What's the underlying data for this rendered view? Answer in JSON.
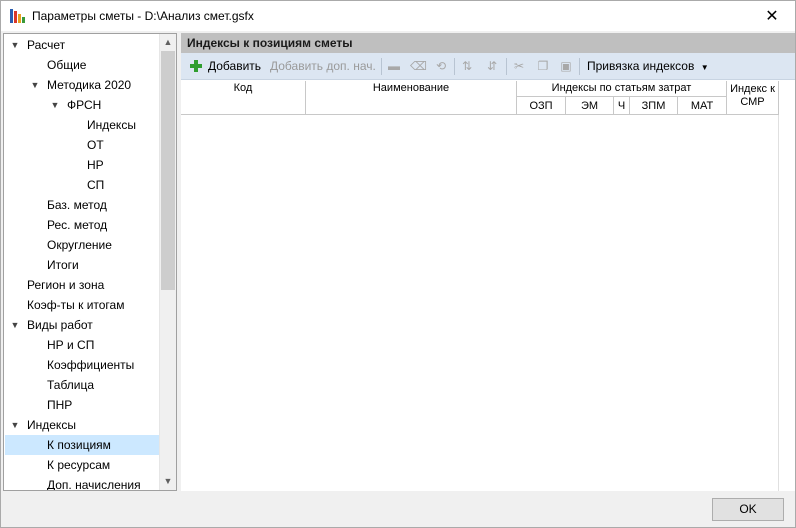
{
  "window": {
    "title": "Параметры сметы - D:\\Анализ смет.gsfx",
    "close_glyph": "✕"
  },
  "tree": {
    "items": [
      {
        "label": "Расчет",
        "expanded": true
      },
      {
        "label": "Общие"
      },
      {
        "label": "Методика 2020",
        "expanded": true
      },
      {
        "label": "ФРСН",
        "expanded": true
      },
      {
        "label": "Индексы"
      },
      {
        "label": "ОТ"
      },
      {
        "label": "НР"
      },
      {
        "label": "СП"
      },
      {
        "label": "Баз. метод"
      },
      {
        "label": "Рес. метод"
      },
      {
        "label": "Округление"
      },
      {
        "label": "Итоги"
      },
      {
        "label": "Регион и зона"
      },
      {
        "label": "Коэф-ты к итогам"
      },
      {
        "label": "Виды работ",
        "expanded": true
      },
      {
        "label": "НР и СП"
      },
      {
        "label": "Коэффициенты"
      },
      {
        "label": "Таблица"
      },
      {
        "label": "ПНР"
      },
      {
        "label": "Индексы",
        "expanded": true
      },
      {
        "label": "К позициям",
        "selected": true
      },
      {
        "label": "К ресурсам"
      },
      {
        "label": "Доп. начисления"
      }
    ]
  },
  "panel": {
    "header": "Индексы к позициям сметы",
    "toolbar": {
      "add_label": "Добавить",
      "add_extra_label": "Добавить доп. нач.",
      "binding_label": "Привязка индексов",
      "icons": [
        "remove-icon",
        "eraser-icon",
        "reset-icon",
        "sort-numeric-icon",
        "sort-alpha-icon",
        "cut-icon",
        "copy-icon",
        "paste-icon"
      ]
    },
    "table": {
      "col_code": "Код",
      "col_name": "Наименование",
      "group_label": "Индексы по статьям затрат",
      "sub_cols": [
        "ОЗП",
        "ЭМ",
        "Ч",
        "ЗПМ",
        "МАТ"
      ],
      "col_smr": "Индекс к СМР",
      "rows": []
    }
  },
  "footer": {
    "ok_label": "OK"
  }
}
